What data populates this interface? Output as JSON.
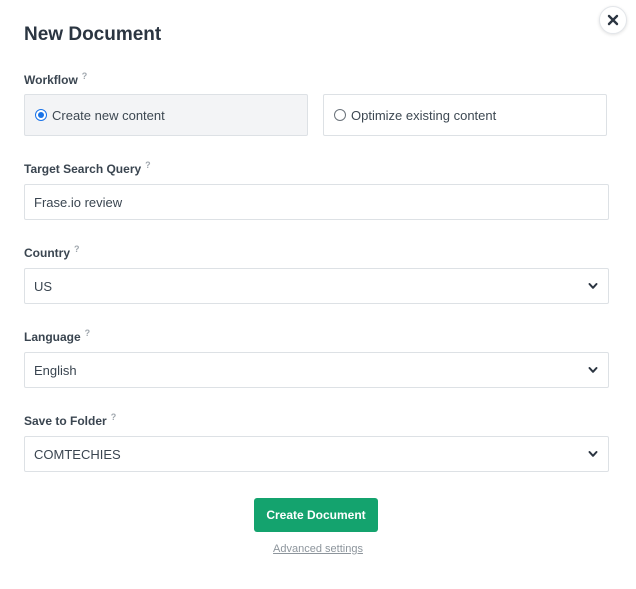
{
  "dialog": {
    "title": "New Document",
    "close_icon": "close-icon"
  },
  "workflow": {
    "label": "Workflow",
    "help": "?",
    "options": [
      {
        "label": "Create new content",
        "selected": true
      },
      {
        "label": "Optimize existing content",
        "selected": false
      }
    ]
  },
  "query": {
    "label": "Target Search Query",
    "help": "?",
    "value": "Frase.io review"
  },
  "country": {
    "label": "Country",
    "help": "?",
    "value": "US"
  },
  "language": {
    "label": "Language",
    "help": "?",
    "value": "English"
  },
  "folder": {
    "label": "Save to Folder",
    "help": "?",
    "value": "COMTECHIES"
  },
  "actions": {
    "create_label": "Create Document",
    "advanced_label": "Advanced settings"
  },
  "colors": {
    "primary": "#14a36e",
    "radio_selected": "#1a73e8"
  }
}
